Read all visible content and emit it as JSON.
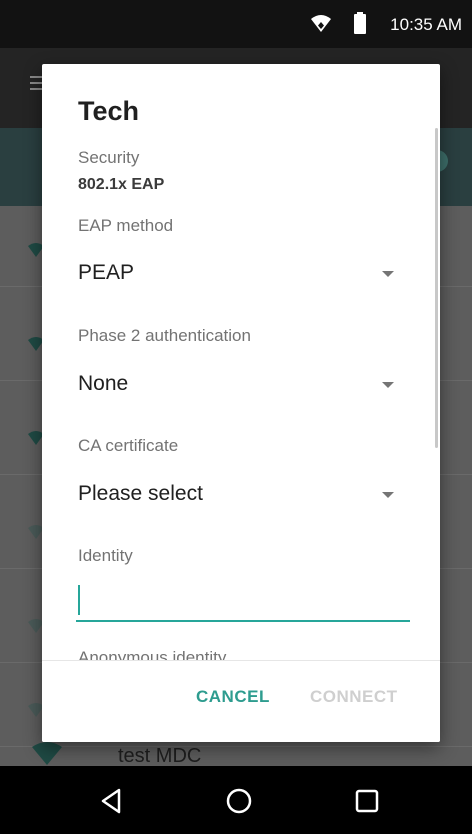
{
  "status_bar": {
    "time": "10:35 AM",
    "icons": [
      "wifi-icon",
      "battery-icon"
    ]
  },
  "background": {
    "last_network_label": "test MDC"
  },
  "dialog": {
    "title": "Tech",
    "security_label": "Security",
    "security_value": "802.1x EAP",
    "eap_method_label": "EAP method",
    "eap_method_value": "PEAP",
    "phase2_label": "Phase 2 authentication",
    "phase2_value": "None",
    "ca_cert_label": "CA certificate",
    "ca_cert_value": "Please select",
    "identity_label": "Identity",
    "identity_value": "",
    "anonymous_identity_label": "Anonymous identity",
    "cancel_label": "CANCEL",
    "connect_label": "CONNECT"
  },
  "colors": {
    "accent": "#26a69a",
    "disabled": "#cfcfcf"
  },
  "nav_bar": {
    "icons": [
      "back-icon",
      "home-icon",
      "recents-icon"
    ]
  }
}
